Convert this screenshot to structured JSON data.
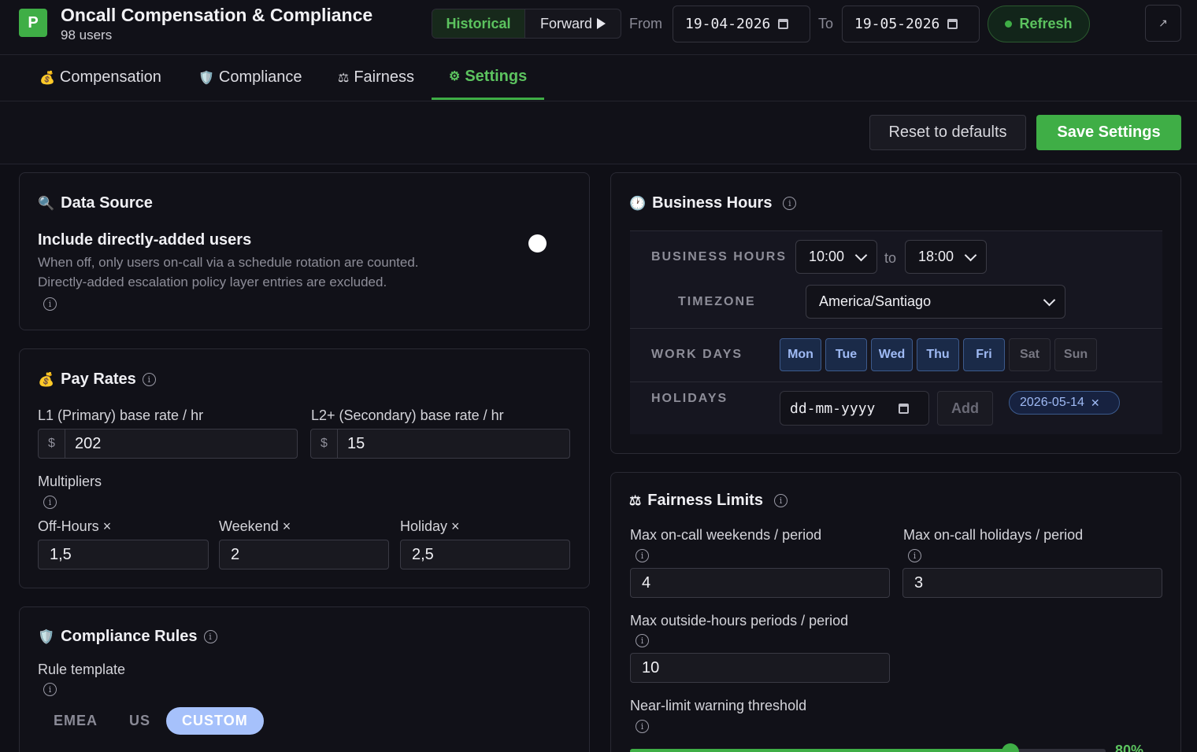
{
  "app": {
    "logo_letter": "P",
    "title": "Oncall Compensation & Compliance",
    "user_count": "98 users"
  },
  "mode_toggle": {
    "historical": "Historical",
    "forward": "Forward"
  },
  "date_range": {
    "from_label": "From",
    "from_value": "19-04-2026",
    "to_label": "To",
    "to_value": "19-05-2026"
  },
  "refresh_label": "Refresh",
  "expand_icon": "↗︎",
  "tabs": [
    {
      "icon": "💰",
      "label": "Compensation"
    },
    {
      "icon": "🛡️",
      "label": "Compliance"
    },
    {
      "icon": "⚖",
      "label": "Fairness"
    },
    {
      "icon": "⚙",
      "label": "Settings"
    }
  ],
  "actions": {
    "reset_label": "Reset to defaults",
    "save_label": "Save Settings"
  },
  "data_source": {
    "title": "Data Source",
    "icon": "🔍",
    "toggle_label": "Include directly-added users",
    "toggle_on": false,
    "description_line1": "When off, only users on-call via a schedule rotation are counted.",
    "description_line2": "Directly-added escalation policy layer entries are excluded."
  },
  "pay_rates": {
    "title": "Pay Rates",
    "icon": "💰",
    "l1_label": "L1 (Primary) base rate / hr",
    "l1_prefix": "$",
    "l1_value": "202",
    "l2_label": "L2+ (Secondary) base rate / hr",
    "l2_prefix": "$",
    "l2_value": "15",
    "multipliers_label": "Multipliers",
    "off_hours_label": "Off-Hours ×",
    "off_hours_value": "1,5",
    "weekend_label": "Weekend ×",
    "weekend_value": "2",
    "holiday_label": "Holiday ×",
    "holiday_value": "2,5"
  },
  "compliance_rules": {
    "title": "Compliance Rules",
    "icon": "🛡️",
    "template_label": "Rule template",
    "templates": [
      "EMEA",
      "US",
      "CUSTOM"
    ],
    "selected_template": "CUSTOM"
  },
  "business_hours": {
    "title": "Business Hours",
    "icon": "🕐",
    "hours_label": "BUSINESS HOURS",
    "start": "10:00",
    "to_label": "to",
    "end": "18:00",
    "timezone_label": "TIMEZONE",
    "timezone": "America/Santiago",
    "workdays_label": "WORK DAYS",
    "days": [
      {
        "label": "Mon",
        "on": true
      },
      {
        "label": "Tue",
        "on": true
      },
      {
        "label": "Wed",
        "on": true
      },
      {
        "label": "Thu",
        "on": true
      },
      {
        "label": "Fri",
        "on": true
      },
      {
        "label": "Sat",
        "on": false
      },
      {
        "label": "Sun",
        "on": false
      }
    ],
    "holidays_label": "HOLIDAYS",
    "holiday_placeholder": "dd-mm-yyyy",
    "add_label": "Add",
    "holiday_chips": [
      "2026-05-14"
    ]
  },
  "fairness_limits": {
    "title": "Fairness Limits",
    "icon": "⚖",
    "max_weekends_label": "Max on-call weekends / period",
    "max_weekends_value": "4",
    "max_holidays_label": "Max on-call holidays / period",
    "max_holidays_value": "3",
    "max_outside_label": "Max outside-hours periods / period",
    "max_outside_value": "10",
    "warning_label": "Near-limit warning threshold",
    "warning_threshold": 0.8
  },
  "colors": {
    "accent": "#3fae46",
    "background": "#0f0f16",
    "selected_day": "#9fbaf4"
  }
}
